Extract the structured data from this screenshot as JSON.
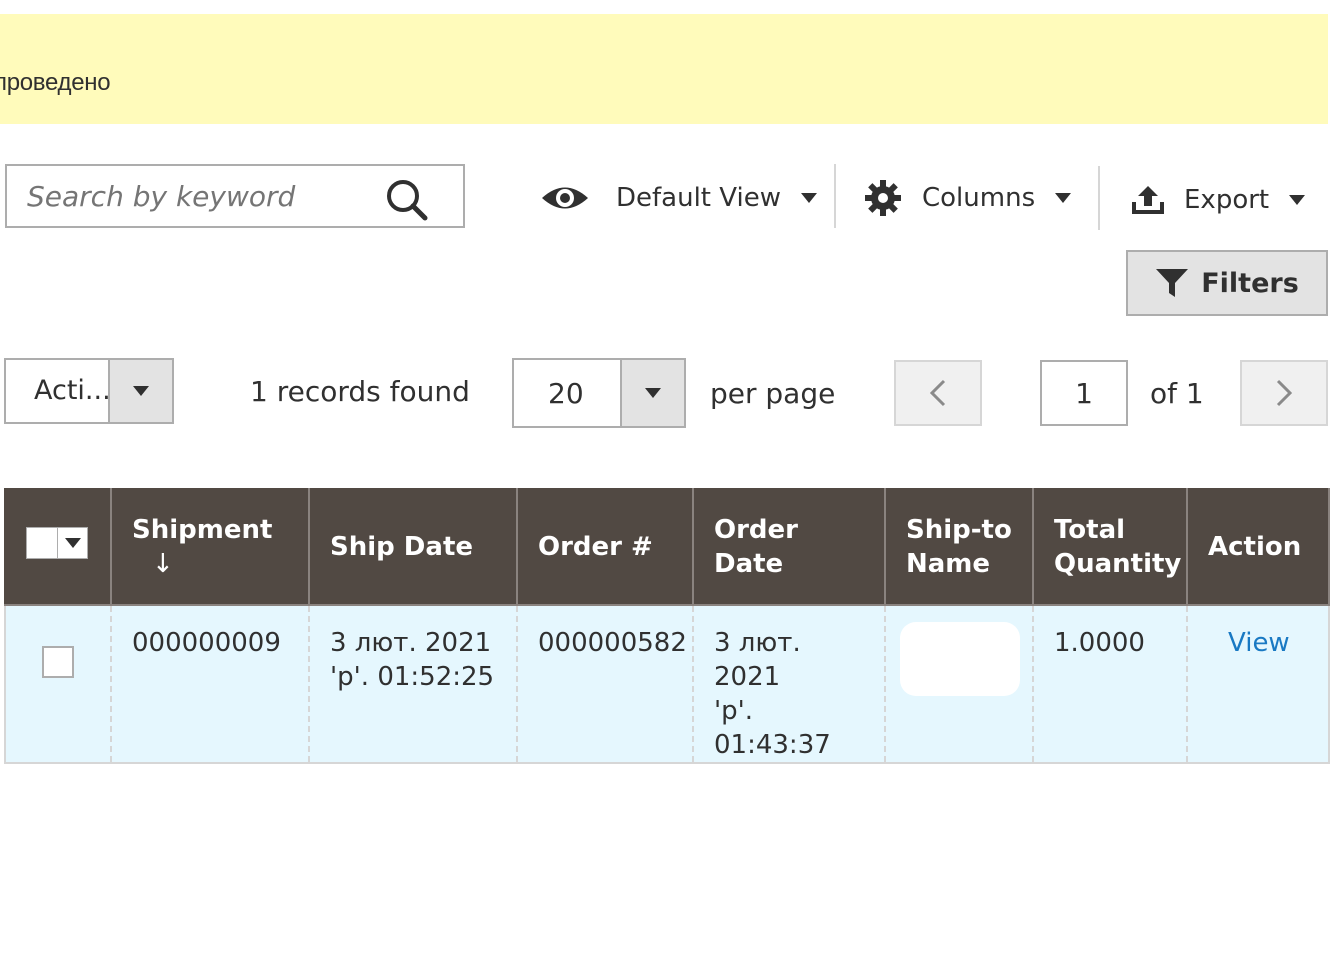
{
  "notice": {
    "text": "проведено"
  },
  "search": {
    "placeholder": "Search by keyword"
  },
  "toolbar": {
    "view_label": "Default View",
    "columns_label": "Columns",
    "export_label": "Export",
    "filters_label": "Filters"
  },
  "actions": {
    "label": "Acti..."
  },
  "records": {
    "text": "1 records found"
  },
  "pager": {
    "per_page": "20",
    "per_page_label": "per page",
    "current_page": "1",
    "of_label": "of 1"
  },
  "table": {
    "headers": {
      "shipment": "Shipment",
      "sort_arrow": "↓",
      "ship_date": "Ship Date",
      "order_no": "Order #",
      "order_date": "Order Date",
      "ship_to_line1": "Ship-to",
      "ship_to_line2": "Name",
      "total_qty_line1": "Total",
      "total_qty_line2": "Quantity",
      "action": "Action"
    },
    "rows": [
      {
        "shipment": "000000009",
        "ship_date_line1": "3 лют. 2021",
        "ship_date_line2": "'р'. 01:52:25",
        "order_no": "000000582",
        "order_date_line1": "3 лют. 2021",
        "order_date_line2": "'р'. 01:43:37",
        "total_qty": "1.0000",
        "action": "View"
      }
    ]
  },
  "colors": {
    "notice_bg": "#fffbbb",
    "header_bg": "#514943",
    "row_bg": "#e5f7fe",
    "link": "#1979c3"
  }
}
